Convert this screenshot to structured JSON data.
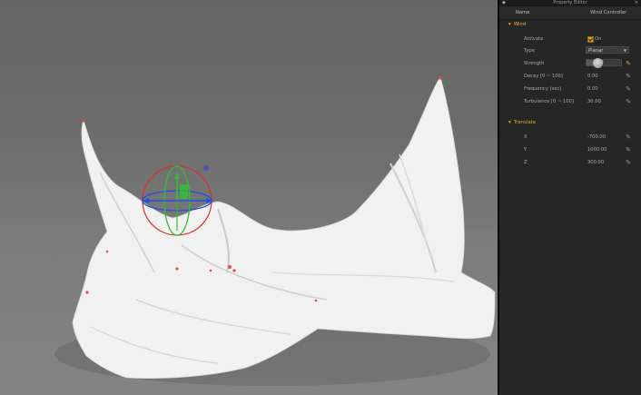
{
  "panel": {
    "title": "Property Editor",
    "header": {
      "name": "Name",
      "value": "Wind Controller"
    },
    "wind_section": {
      "title": "Wind",
      "activate": {
        "label": "Activate",
        "checked": true,
        "text": "On"
      },
      "type": {
        "label": "Type",
        "value": "Planar"
      },
      "strength": {
        "label": "Strength",
        "value": "50",
        "fraction": 0.3
      },
      "decay": {
        "label": "Decay [0 ~ 100]",
        "value": "0.00"
      },
      "frequency": {
        "label": "Frequency (sec)",
        "value": "0.00"
      },
      "turbulence": {
        "label": "Turbulence [0 ~ 100]",
        "value": "30.00"
      }
    },
    "translate_section": {
      "title": "Translate",
      "x": {
        "label": "X",
        "value": "-700.00"
      },
      "y": {
        "label": "Y",
        "value": "1000.00"
      },
      "z": {
        "label": "Z",
        "value": "300.00"
      }
    }
  },
  "colors": {
    "accent": "#e0b030",
    "gizmo_red": "#e03030",
    "gizmo_green": "#30c030",
    "gizmo_blue": "#2050e0",
    "cloth": "#f2f2f2",
    "panel_bg": "#262626"
  }
}
